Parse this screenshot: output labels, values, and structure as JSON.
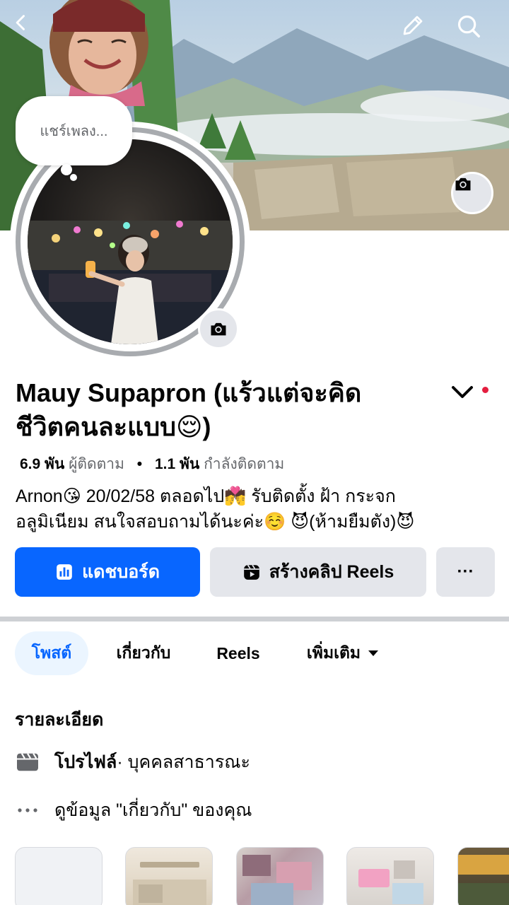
{
  "header": {
    "back_icon": "chevron-left-icon",
    "edit_icon": "pencil-icon",
    "search_icon": "search-icon"
  },
  "profile": {
    "thought_bubble": "แชร์เพลง...",
    "name_line1": "Mauy Supapron (แร้วแต่จะคิด",
    "name_line2": "ชีวิตคนละแบบ😌)",
    "followers_count": "6.9 พัน",
    "followers_label": "ผู้ติดตาม",
    "following_count": "1.1 พัน",
    "following_label": "กำลังติดตาม",
    "bio_line1": "Arnon😘 20/02/58 ตลอดไป💏 รับติดตั้ง ฝ้า กระจก",
    "bio_line2": "อลูมิเนียม สนใจสอบถามได้นะค่ะ☺️ 😈(ห้ามยืมตัง)😈"
  },
  "actions": {
    "dashboard_label": "แดชบอร์ด",
    "reels_label": "สร้างคลิป Reels",
    "more_label": "···"
  },
  "tabs": [
    {
      "label": "โพสต์",
      "active": true
    },
    {
      "label": "เกี่ยวกับ"
    },
    {
      "label": "Reels"
    },
    {
      "label": "เพิ่มเติม"
    }
  ],
  "details": {
    "title": "รายละเอียด",
    "profile_type_bold": "โปรไฟล์",
    "profile_type_rest": " · บุคคลสาธารณะ",
    "about_link": "ดูข้อมูล \"เกี่ยวกับ\" ของคุณ"
  },
  "colors": {
    "accent": "#0866ff",
    "secondary_button": "#e4e6eb",
    "notification_dot": "#e41e3f"
  }
}
